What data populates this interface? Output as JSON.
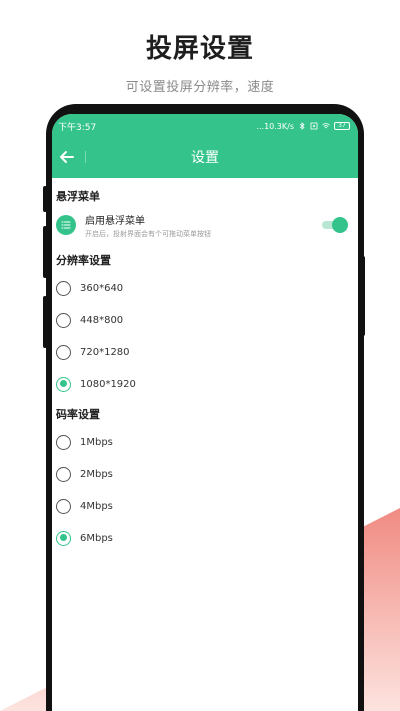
{
  "promo": {
    "title": "投屏设置",
    "subtitle": "可设置投屏分辨率，速度"
  },
  "status_bar": {
    "time": "下午3:57",
    "network_speed": "...10.3K/s",
    "icons": [
      "bluetooth-icon",
      "sim-icon",
      "wifi-icon",
      "battery-icon"
    ],
    "battery": "37"
  },
  "toolbar": {
    "back_icon": "back-arrow-icon",
    "title": "设置"
  },
  "float_menu": {
    "section_title": "悬浮菜单",
    "icon": "list-icon",
    "label": "启用悬浮菜单",
    "description": "开启后，投射界面会有个可拖动菜单按钮",
    "enabled": true
  },
  "resolution": {
    "section_title": "分辨率设置",
    "options": [
      {
        "label": "360*640",
        "checked": false
      },
      {
        "label": "448*800",
        "checked": false
      },
      {
        "label": "720*1280",
        "checked": false
      },
      {
        "label": "1080*1920",
        "checked": true
      }
    ]
  },
  "bitrate": {
    "section_title": "码率设置",
    "options": [
      {
        "label": "1Mbps",
        "checked": false
      },
      {
        "label": "2Mbps",
        "checked": false
      },
      {
        "label": "4Mbps",
        "checked": false
      },
      {
        "label": "6Mbps",
        "checked": true
      }
    ]
  },
  "colors": {
    "accent": "#34c48b",
    "accent_light": "#b7e6d3",
    "wedge_top": "#f08b82",
    "wedge_bottom": "#fde3df"
  }
}
